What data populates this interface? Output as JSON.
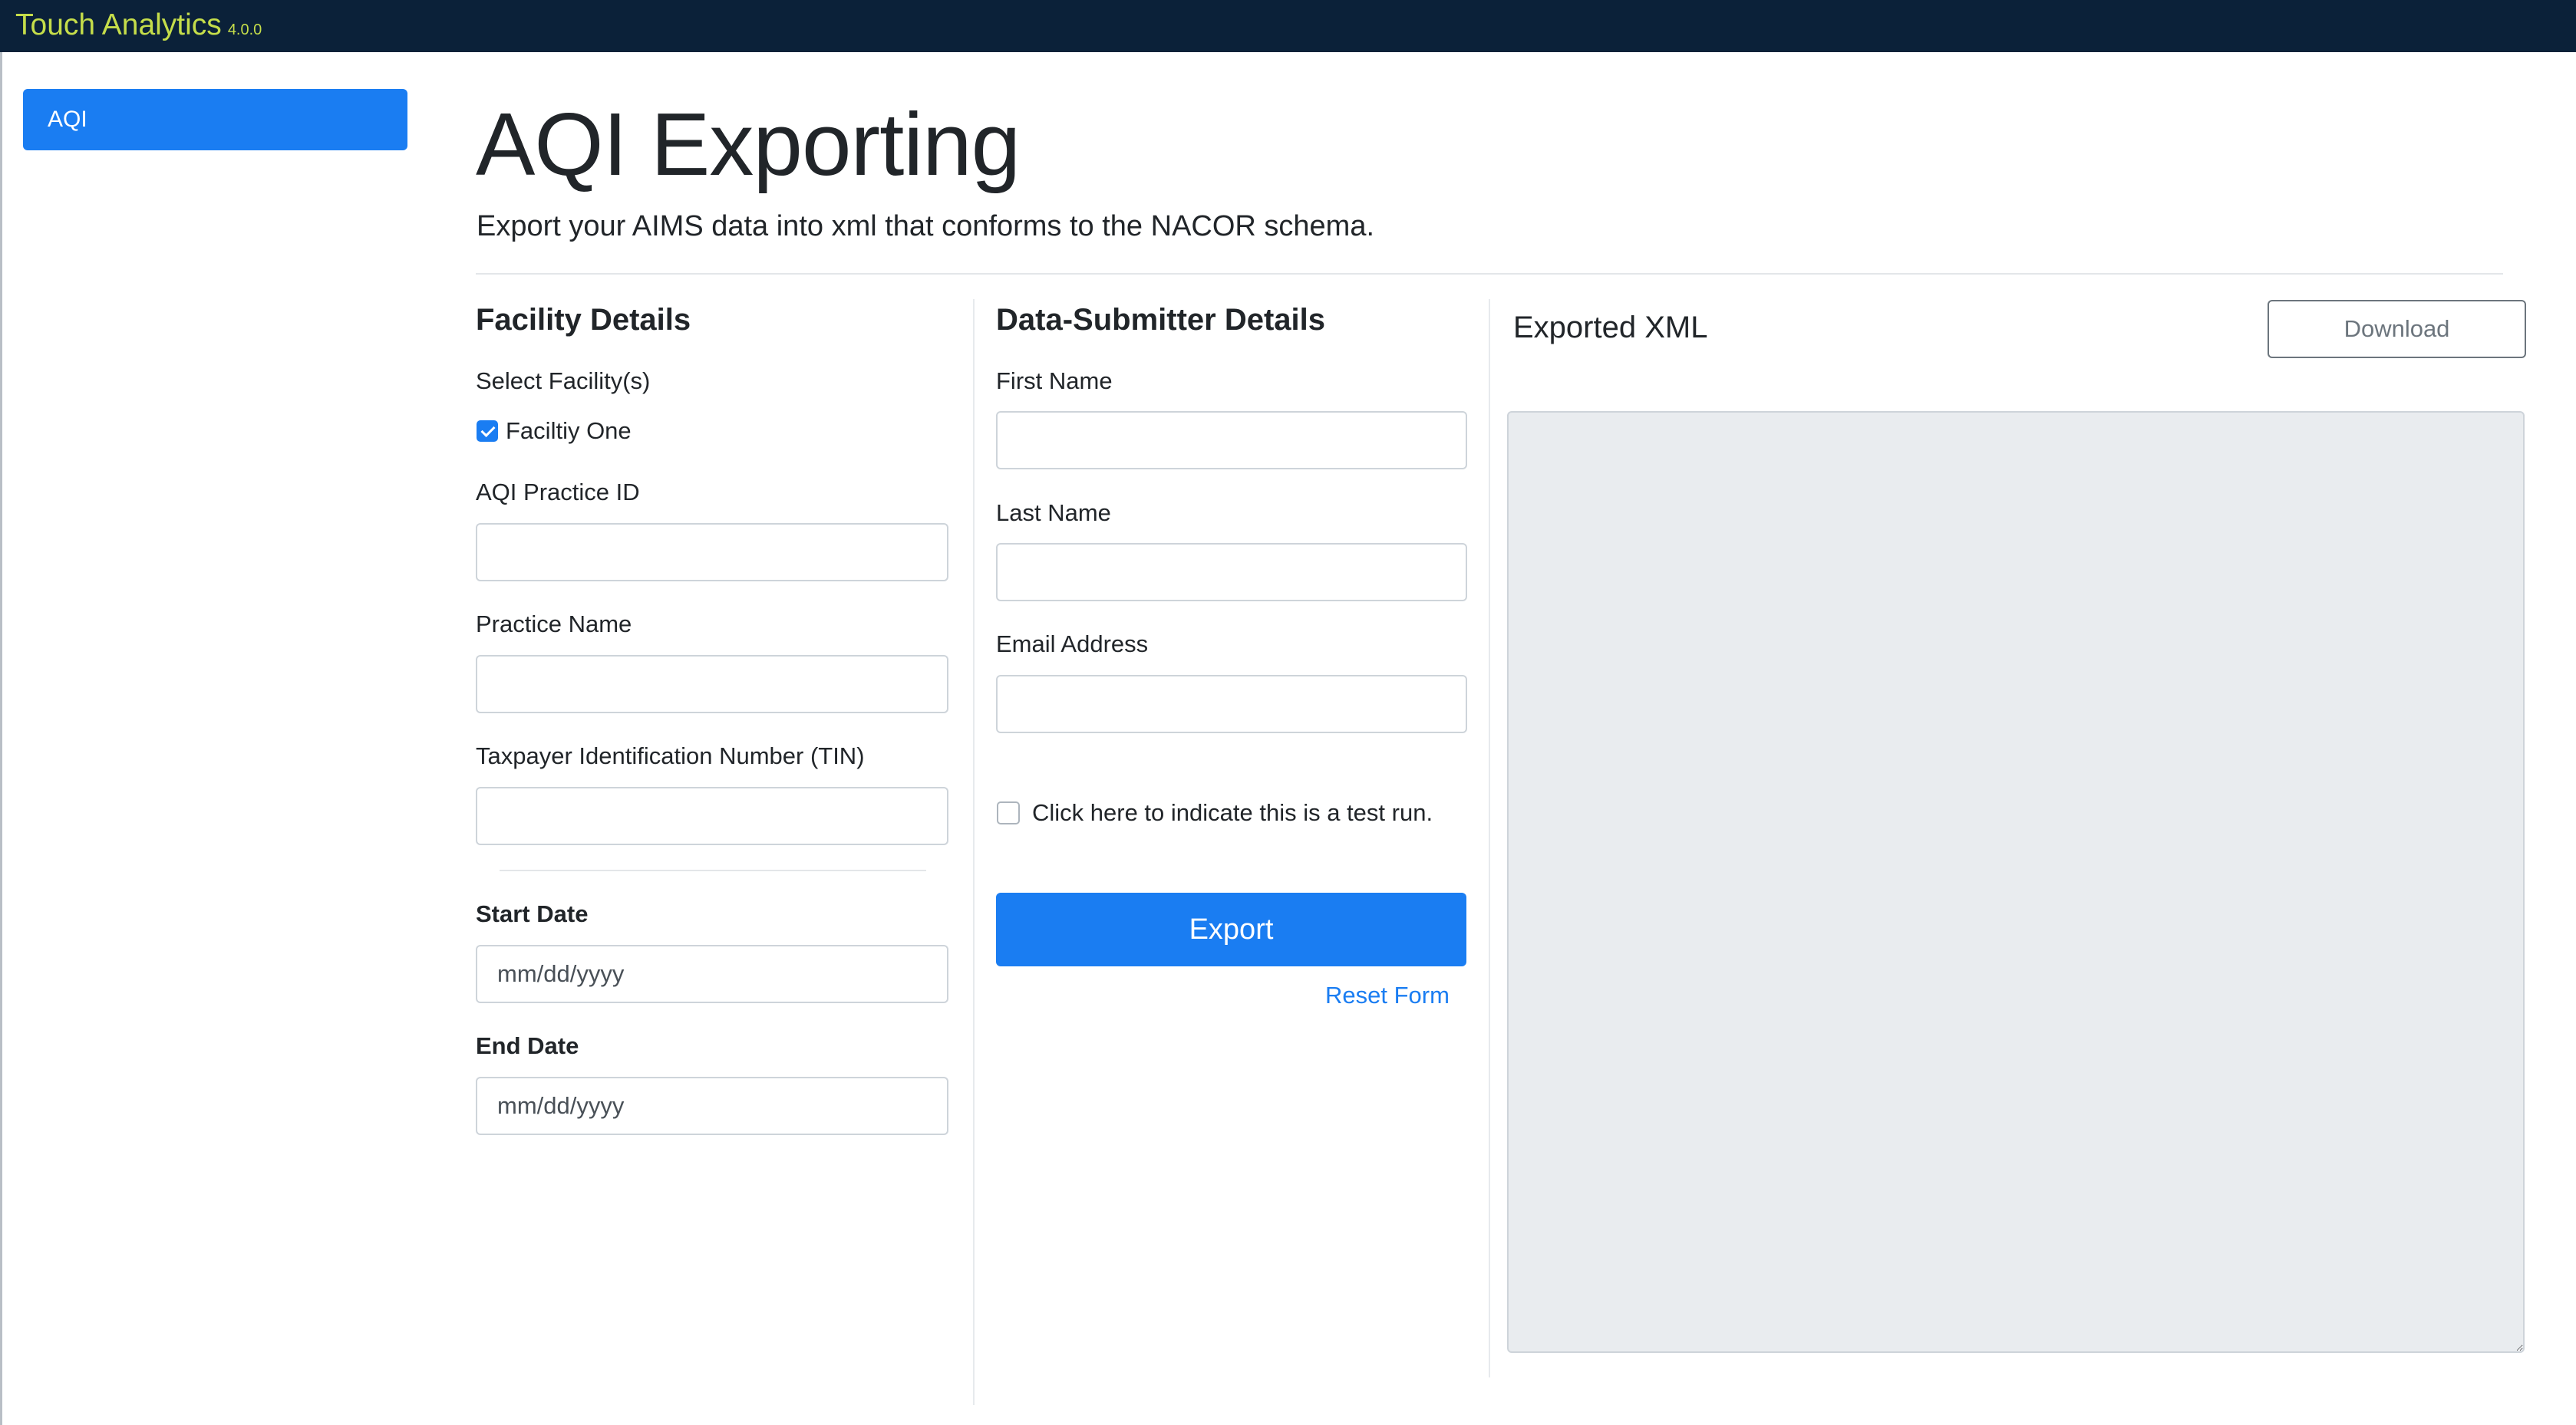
{
  "app": {
    "name": "Touch Analytics",
    "version": "4.0.0"
  },
  "sidebar": {
    "items": [
      {
        "label": "AQI",
        "active": true
      }
    ]
  },
  "page": {
    "title": "AQI Exporting",
    "subtitle": "Export your AIMS data into xml that conforms to the NACOR schema."
  },
  "facility": {
    "title": "Facility Details",
    "select_label": "Select Facility(s)",
    "facilities": [
      {
        "label": "Faciltiy One",
        "checked": true
      }
    ],
    "practice_id_label": "AQI Practice ID",
    "practice_id_value": "",
    "practice_name_label": "Practice Name",
    "practice_name_value": "",
    "tin_label": "Taxpayer Identification Number (TIN)",
    "tin_value": "",
    "start_date_label": "Start Date",
    "start_date_placeholder": "mm/dd/yyyy",
    "end_date_label": "End Date",
    "end_date_placeholder": "mm/dd/yyyy"
  },
  "submitter": {
    "title": "Data-Submitter Details",
    "first_name_label": "First Name",
    "first_name_value": "",
    "last_name_label": "Last Name",
    "last_name_value": "",
    "email_label": "Email Address",
    "email_value": "",
    "test_run_label": "Click here to indicate this is a test run.",
    "test_run_checked": false,
    "export_label": "Export",
    "reset_label": "Reset Form"
  },
  "xml": {
    "title": "Exported XML",
    "download_label": "Download",
    "content": ""
  },
  "colors": {
    "topbar": "#0b2139",
    "brand": "#c5dd4a",
    "primary": "#1a7df2",
    "readonly_bg": "#e9ecef"
  }
}
